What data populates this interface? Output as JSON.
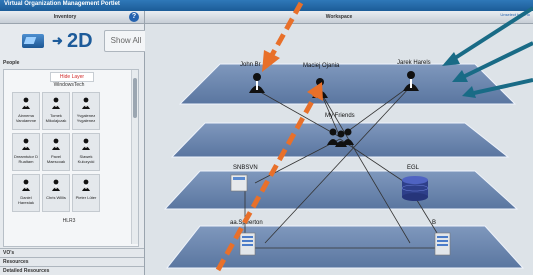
{
  "window": {
    "title": "Virtual Organization Management Portlet"
  },
  "inventory": {
    "title": "Inventory",
    "help_label": "?",
    "mode_label": "2D",
    "show_all_label": "Show All",
    "sections": {
      "people": "People",
      "vos": "VO's",
      "resources": "Resources",
      "detailed_resources": "Detailed Resources"
    },
    "hide_layer_label": "Hide Layer",
    "group_name": "WindowsTech",
    "subgroup_label": "HLR3",
    "people": [
      {
        "name": "Ainnema Vandamme"
      },
      {
        "name": "Tomek Mikolajczak"
      },
      {
        "name": "Yvgalenez Yvgalenez"
      },
      {
        "name": "Dreamtutor D Rualtam"
      },
      {
        "name": "Pavel Maescoak"
      },
      {
        "name": "Slawek Kulczycki"
      },
      {
        "name": "Daniel Harestak"
      },
      {
        "name": "Chris Willis"
      },
      {
        "name": "Pieter Lüter"
      }
    ]
  },
  "workspace": {
    "title": "Workspace",
    "tools_label": "Unselect back to",
    "layers": {
      "people": [
        "John Br",
        "Maciej Ojania",
        "Jarek Harels"
      ],
      "group": "My Friends",
      "services": [
        "SNBSVN",
        "EGL"
      ],
      "bottom": [
        "aa.Speerton",
        "B"
      ]
    }
  }
}
